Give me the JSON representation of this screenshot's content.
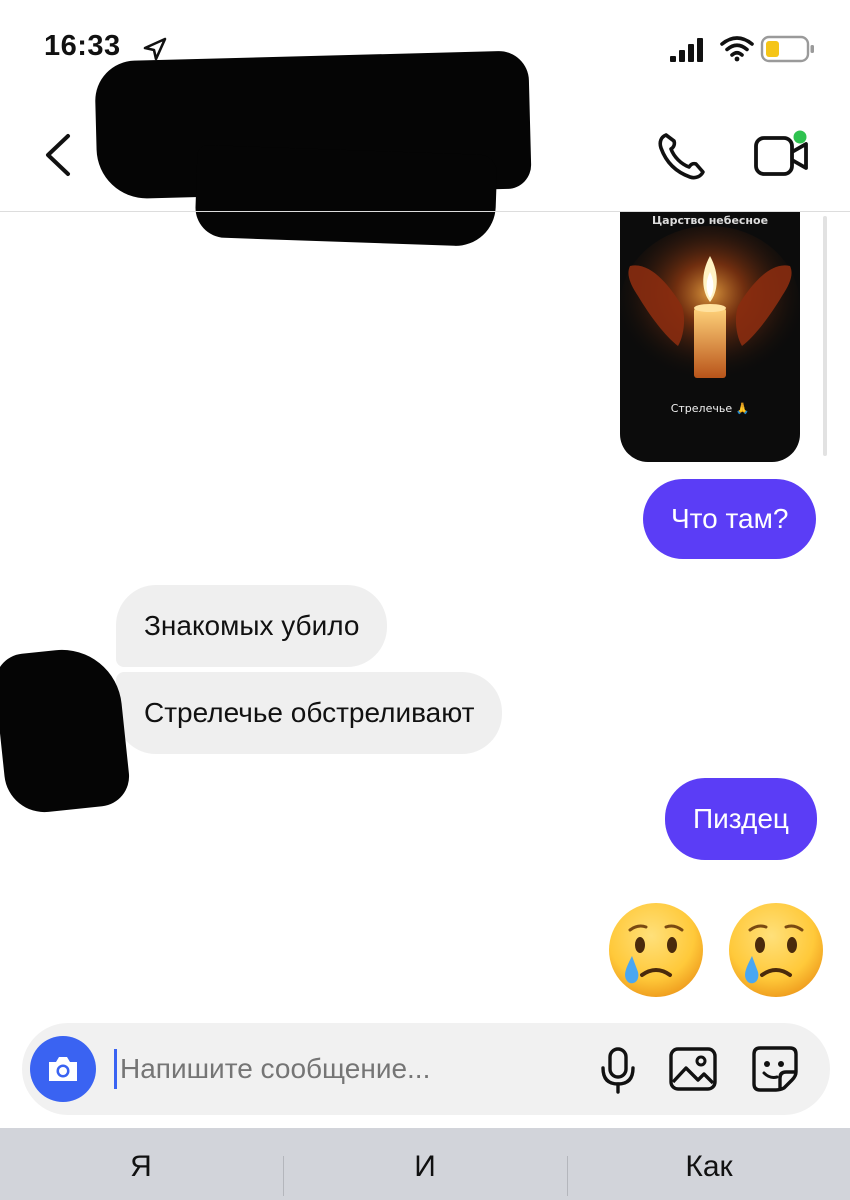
{
  "status_bar": {
    "time": "16:33"
  },
  "header": {
    "back_icon": "chevron-left-icon",
    "call_icon": "phone-icon",
    "video_icon": "video-camera-icon"
  },
  "story": {
    "top_text": "Царство небесное",
    "caption": "Стрелечье 🙏"
  },
  "messages": [
    {
      "direction": "outgoing",
      "text": "Что там?"
    },
    {
      "direction": "incoming",
      "text": "Знакомых убило"
    },
    {
      "direction": "incoming",
      "text": "Стрелечье обстреливают"
    },
    {
      "direction": "outgoing",
      "text": "Пиздец"
    },
    {
      "direction": "outgoing",
      "text": "😢😢"
    }
  ],
  "composer": {
    "placeholder": "Напишите сообщение...",
    "camera_icon": "camera-icon",
    "mic_icon": "microphone-icon",
    "gallery_icon": "gallery-icon",
    "sticker_icon": "sticker-icon"
  },
  "keyboard": {
    "suggestions": [
      "Я",
      "И",
      "Как"
    ]
  },
  "colors": {
    "outgoing_bubble": "#5b3df6",
    "incoming_bubble": "#efefef",
    "camera_button": "#3a63f2",
    "keyboard_bar": "#d2d4da"
  }
}
